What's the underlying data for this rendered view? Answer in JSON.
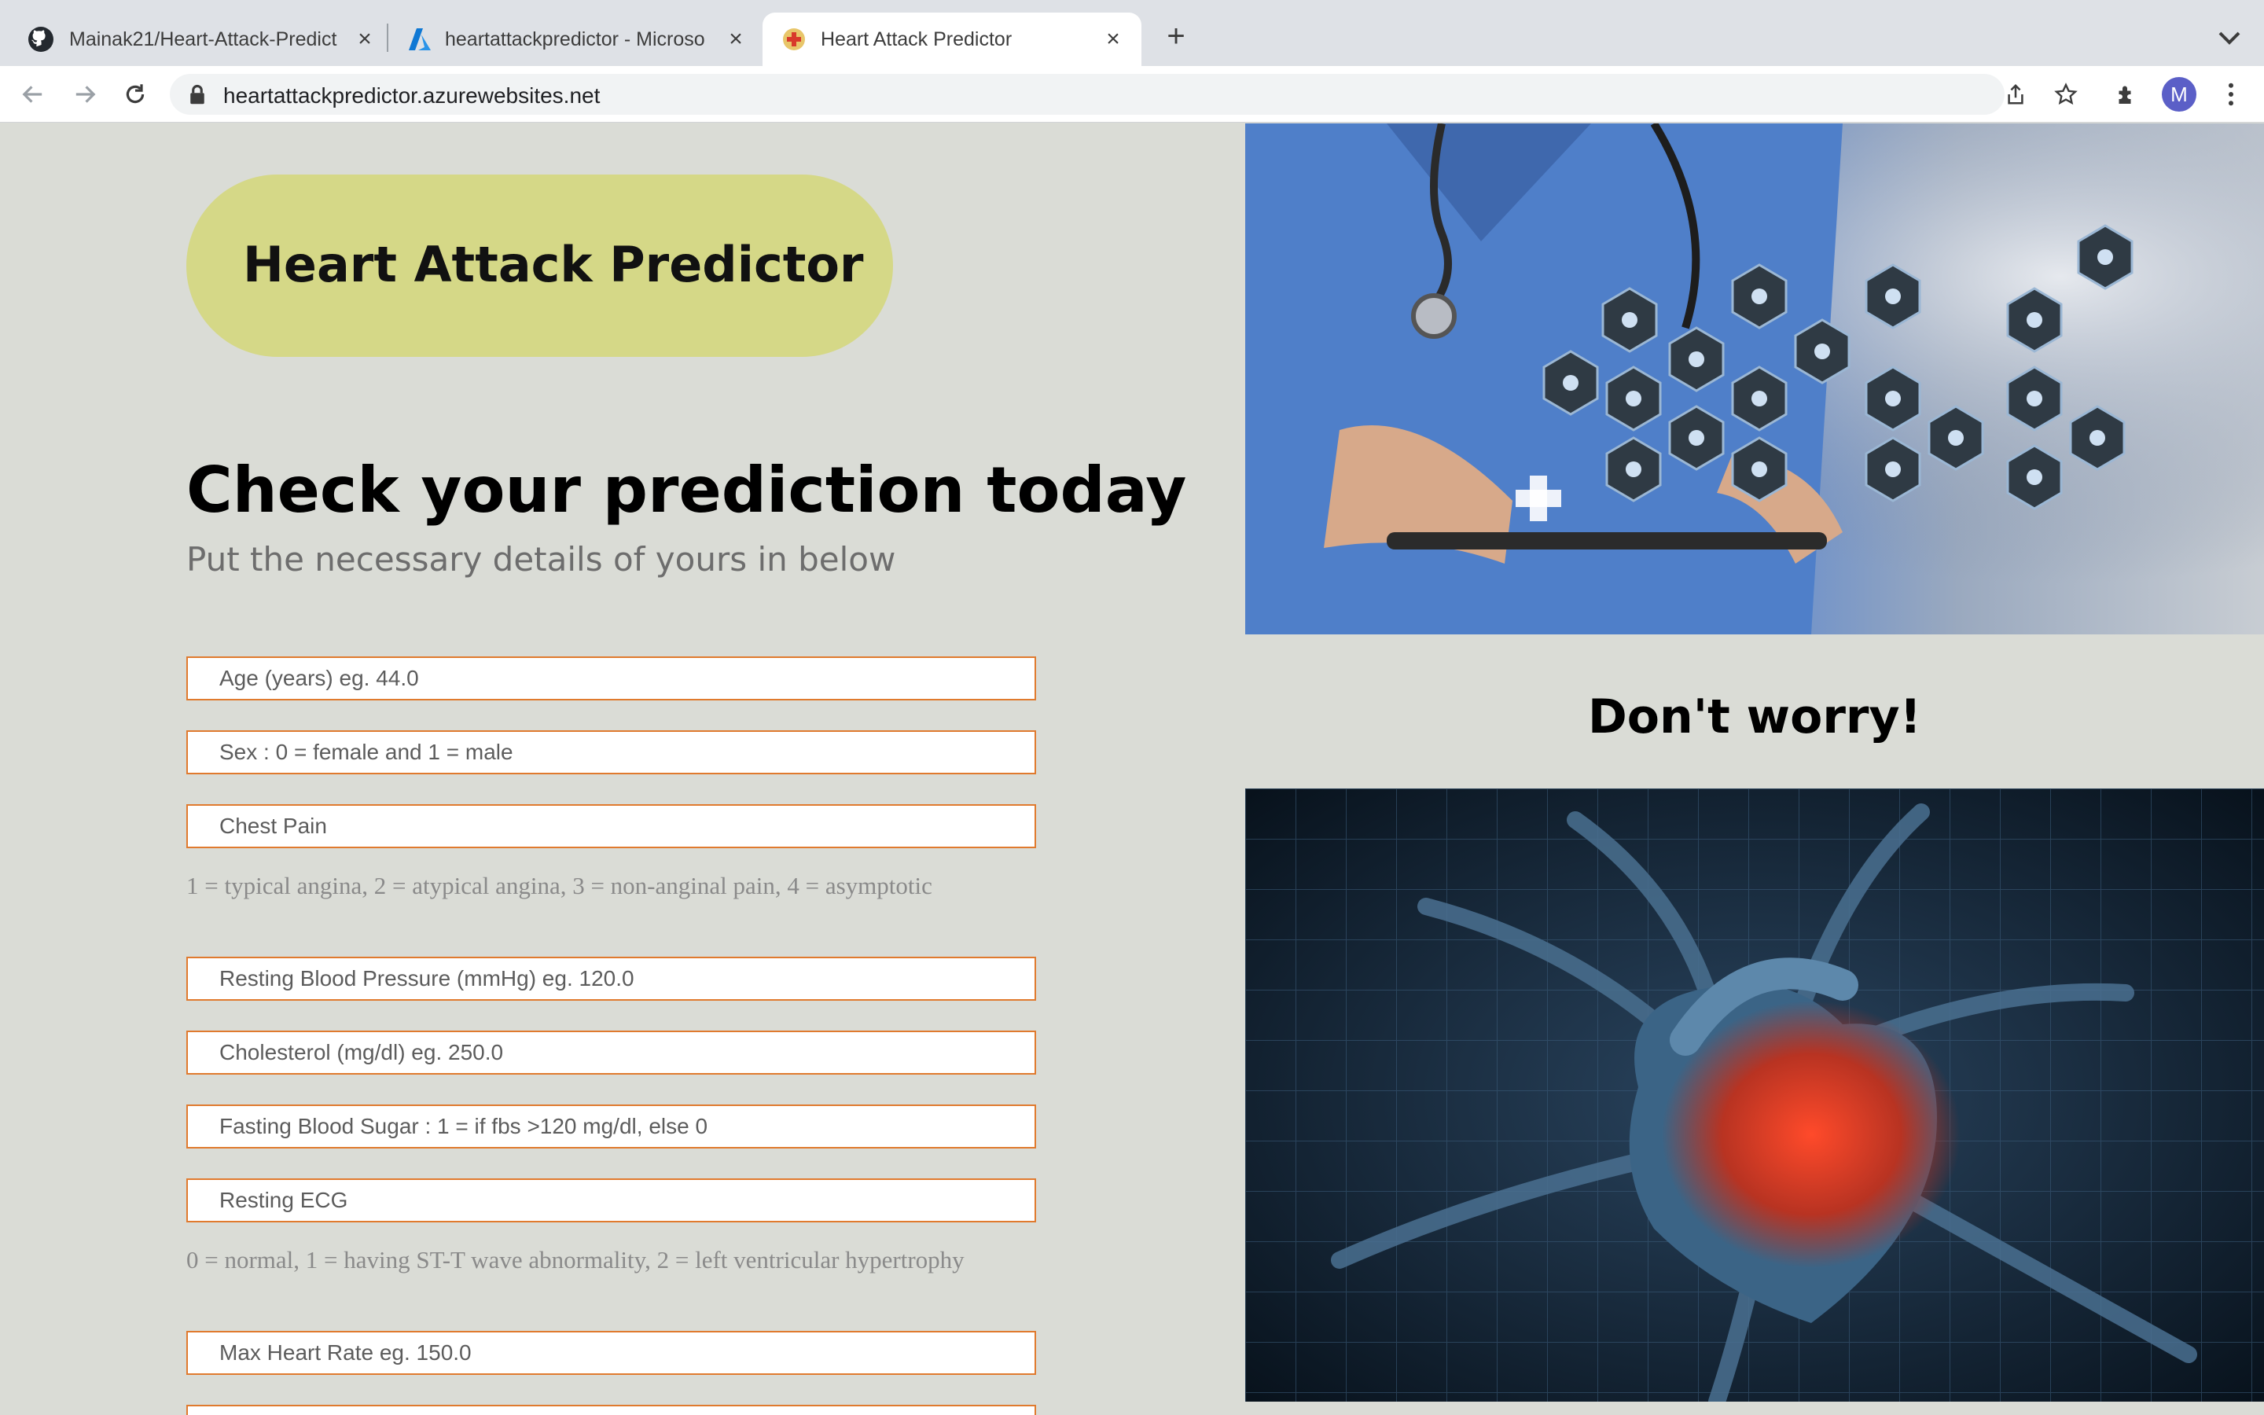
{
  "browser": {
    "tabs": [
      {
        "title": "Mainak21/Heart-Attack-Predict",
        "icon": "github-icon"
      },
      {
        "title": "heartattackpredictor - Microso",
        "icon": "azure-icon"
      },
      {
        "title": "Heart Attack Predictor",
        "icon": "medical-cross-icon",
        "active": true
      }
    ],
    "url": "heartattackpredictor.azurewebsites.net",
    "profile_initial": "M"
  },
  "page": {
    "brand_title": "Heart Attack Predictor",
    "heading": "Check your prediction today",
    "subheading": "Put the necessary details of yours in below",
    "fields": [
      {
        "placeholder": "Age (years) eg. 44.0"
      },
      {
        "placeholder": "Sex : 0 = female and 1 = male"
      },
      {
        "placeholder": "Chest Pain",
        "hint": "1 = typical angina, 2 = atypical angina, 3 = non-anginal pain, 4 = asymptotic"
      },
      {
        "placeholder": "Resting Blood Pressure (mmHg) eg. 120.0"
      },
      {
        "placeholder": "Cholesterol (mg/dl) eg. 250.0"
      },
      {
        "placeholder": "Fasting Blood Sugar : 1 = if fbs >120 mg/dl, else 0"
      },
      {
        "placeholder": "Resting ECG",
        "hint": "0 = normal, 1 = having ST-T wave abnormality, 2 = left ventricular hypertrophy"
      },
      {
        "placeholder": "Max Heart Rate eg. 150.0"
      }
    ],
    "side_heading": "Don't worry!"
  },
  "colors": {
    "page_bg": "#dadcd6",
    "brand_pill": "#d5d887",
    "field_border": "#e07a2e"
  }
}
